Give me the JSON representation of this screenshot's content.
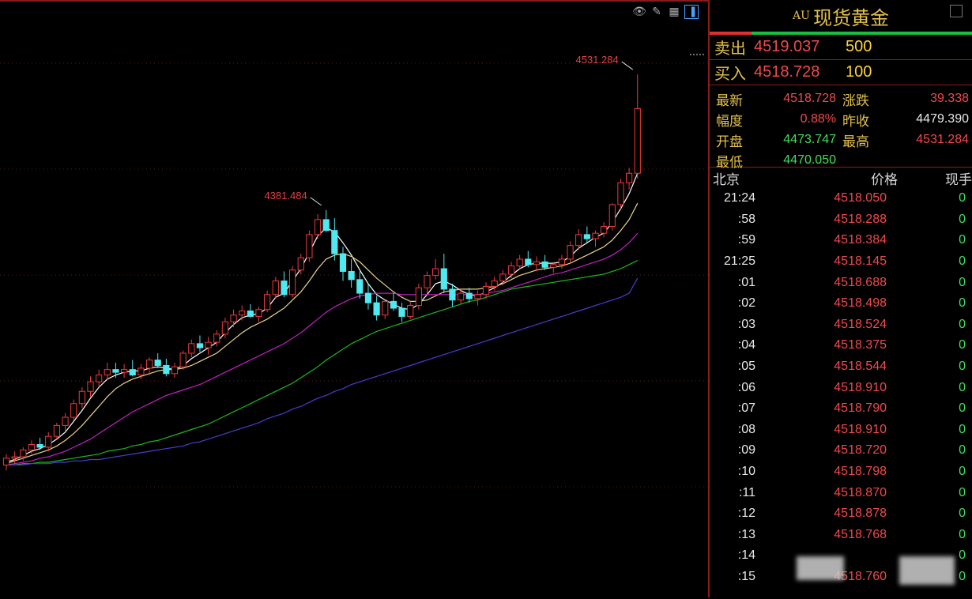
{
  "toolbar": {
    "icons": [
      "eye-icon",
      "pen-icon",
      "grid-icon",
      "panel-icon"
    ]
  },
  "chart_annotations": {
    "high_label": "4531.284",
    "peak_label": "4381.484"
  },
  "chart_data": {
    "type": "candlestick",
    "ylim": [
      4380,
      4540
    ],
    "candles": [
      [
        4388.0,
        4392.0,
        4386.0,
        4390.5
      ],
      [
        4390.5,
        4393.0,
        4388.5,
        4391.0
      ],
      [
        4391.0,
        4394.5,
        4389.5,
        4393.5
      ],
      [
        4393.5,
        4397.0,
        4392.0,
        4395.5
      ],
      [
        4395.5,
        4398.0,
        4393.5,
        4394.5
      ],
      [
        4394.5,
        4400.0,
        4393.0,
        4398.5
      ],
      [
        4398.5,
        4403.5,
        4397.5,
        4402.5
      ],
      [
        4402.5,
        4407.0,
        4400.5,
        4405.5
      ],
      [
        4405.5,
        4412.0,
        4404.5,
        4410.5
      ],
      [
        4410.5,
        4416.5,
        4409.0,
        4415.0
      ],
      [
        4415.0,
        4420.5,
        4413.0,
        4418.5
      ],
      [
        4418.5,
        4423.0,
        4416.5,
        4421.0
      ],
      [
        4421.0,
        4425.5,
        4419.0,
        4423.0
      ],
      [
        4423.0,
        4425.5,
        4420.0,
        4422.0
      ],
      [
        4422.0,
        4425.0,
        4420.0,
        4423.0
      ],
      [
        4423.0,
        4426.5,
        4420.5,
        4421.0
      ],
      [
        4421.0,
        4425.0,
        4419.5,
        4423.5
      ],
      [
        4423.5,
        4427.5,
        4421.0,
        4426.5
      ],
      [
        4426.5,
        4429.0,
        4423.5,
        4424.5
      ],
      [
        4424.5,
        4427.0,
        4420.5,
        4421.5
      ],
      [
        4421.5,
        4425.5,
        4420.0,
        4424.0
      ],
      [
        4424.0,
        4430.0,
        4423.0,
        4429.0
      ],
      [
        4429.0,
        4434.0,
        4427.5,
        4432.5
      ],
      [
        4432.5,
        4435.5,
        4429.5,
        4431.0
      ],
      [
        4431.0,
        4435.0,
        4428.5,
        4433.0
      ],
      [
        4433.0,
        4437.5,
        4431.5,
        4436.0
      ],
      [
        4436.0,
        4442.0,
        4434.5,
        4440.5
      ],
      [
        4440.5,
        4445.0,
        4438.5,
        4443.0
      ],
      [
        4443.0,
        4446.5,
        4441.0,
        4444.5
      ],
      [
        4444.5,
        4447.0,
        4442.0,
        4442.5
      ],
      [
        4442.5,
        4446.0,
        4440.5,
        4445.0
      ],
      [
        4445.0,
        4452.0,
        4444.0,
        4450.5
      ],
      [
        4450.5,
        4457.0,
        4449.0,
        4455.5
      ],
      [
        4455.5,
        4459.0,
        4449.5,
        4450.5
      ],
      [
        4450.5,
        4461.0,
        4449.5,
        4459.5
      ],
      [
        4459.5,
        4465.5,
        4458.0,
        4464.0
      ],
      [
        4464.0,
        4474.0,
        4462.5,
        4472.5
      ],
      [
        4472.5,
        4480.0,
        4471.0,
        4478.0
      ],
      [
        4478.0,
        4481.484,
        4473.5,
        4474.0
      ],
      [
        4474.0,
        4478.5,
        4463.0,
        4465.5
      ],
      [
        4465.5,
        4468.0,
        4455.5,
        4459.0
      ],
      [
        4459.0,
        4463.5,
        4453.0,
        4456.0
      ],
      [
        4456.0,
        4459.0,
        4449.0,
        4451.0
      ],
      [
        4451.0,
        4454.5,
        4445.0,
        4447.5
      ],
      [
        4447.5,
        4450.0,
        4441.0,
        4443.0
      ],
      [
        4443.0,
        4449.0,
        4441.5,
        4448.0
      ],
      [
        4448.0,
        4451.0,
        4444.5,
        4445.5
      ],
      [
        4445.5,
        4447.5,
        4440.5,
        4442.5
      ],
      [
        4442.5,
        4448.0,
        4441.5,
        4446.5
      ],
      [
        4446.5,
        4454.5,
        4445.0,
        4453.0
      ],
      [
        4453.0,
        4459.0,
        4451.0,
        4457.5
      ],
      [
        4457.5,
        4463.5,
        4456.0,
        4460.0
      ],
      [
        4460.0,
        4465.5,
        4451.0,
        4452.5
      ],
      [
        4452.5,
        4454.5,
        4446.0,
        4448.5
      ],
      [
        4448.5,
        4452.5,
        4447.0,
        4451.0
      ],
      [
        4451.0,
        4453.0,
        4447.5,
        4449.0
      ],
      [
        4449.0,
        4452.0,
        4446.5,
        4450.5
      ],
      [
        4450.5,
        4455.0,
        4449.0,
        4453.5
      ],
      [
        4453.5,
        4457.0,
        4452.0,
        4455.5
      ],
      [
        4455.5,
        4459.5,
        4454.0,
        4458.0
      ],
      [
        4458.0,
        4462.5,
        4456.5,
        4461.0
      ],
      [
        4461.0,
        4465.0,
        4459.5,
        4463.5
      ],
      [
        4463.5,
        4466.5,
        4460.5,
        4461.5
      ],
      [
        4461.5,
        4464.5,
        4459.0,
        4462.5
      ],
      [
        4462.5,
        4465.0,
        4459.5,
        4460.5
      ],
      [
        4460.5,
        4462.5,
        4458.5,
        4461.5
      ],
      [
        4461.5,
        4465.0,
        4460.0,
        4463.5
      ],
      [
        4463.5,
        4470.0,
        4462.0,
        4468.5
      ],
      [
        4468.5,
        4474.5,
        4467.0,
        4472.5
      ],
      [
        4472.5,
        4475.5,
        4469.5,
        4471.0
      ],
      [
        4471.0,
        4474.0,
        4468.0,
        4473.0
      ],
      [
        4473.0,
        4477.0,
        4471.5,
        4475.5
      ],
      [
        4475.5,
        4484.0,
        4474.0,
        4483.5
      ],
      [
        4483.5,
        4493.0,
        4482.0,
        4491.5
      ],
      [
        4491.5,
        4497.0,
        4489.0,
        4495.0
      ],
      [
        4495.0,
        4531.284,
        4493.0,
        4518.728
      ]
    ],
    "series": [
      {
        "color": "#ffffff",
        "values": [
          4389.0,
          4390.0,
          4391.5,
          4393.0,
          4394.0,
          4395.5,
          4397.5,
          4400.0,
          4404.0,
          4408.0,
          4412.5,
          4416.5,
          4419.5,
          4421.0,
          4422.0,
          4422.5,
          4422.5,
          4423.5,
          4424.0,
          4423.5,
          4423.0,
          4424.5,
          4427.0,
          4429.0,
          4431.0,
          4433.0,
          4436.5,
          4439.5,
          4442.0,
          4443.0,
          4443.5,
          4445.5,
          4449.5,
          4451.0,
          4455.5,
          4460.0,
          4466.0,
          4472.0,
          4475.0,
          4473.5,
          4469.5,
          4465.0,
          4459.5,
          4454.5,
          4450.5,
          4448.5,
          4447.0,
          4445.5,
          4445.0,
          4447.0,
          4450.5,
          4454.5,
          4455.5,
          4454.0,
          4452.0,
          4450.5,
          4450.0,
          4451.5,
          4453.0,
          4455.0,
          4457.5,
          4460.0,
          4461.5,
          4462.0,
          4462.0,
          4462.0,
          4462.5,
          4464.5,
          4467.5,
          4469.5,
          4471.5,
          4473.0,
          4477.0,
          4482.0,
          4487.5,
          4495.0
        ]
      },
      {
        "color": "#e8d58a",
        "values": [
          4388.5,
          4389.5,
          4390.5,
          4391.5,
          4392.5,
          4393.5,
          4395.0,
          4397.0,
          4399.5,
          4402.5,
          4406.0,
          4409.5,
          4413.0,
          4416.0,
          4418.0,
          4419.5,
          4420.5,
          4421.5,
          4422.5,
          4423.0,
          4423.0,
          4423.5,
          4424.5,
          4426.0,
          4427.5,
          4429.0,
          4431.5,
          4434.0,
          4436.5,
          4438.5,
          4440.0,
          4441.5,
          4443.5,
          4445.5,
          4448.5,
          4451.5,
          4455.5,
          4460.0,
          4463.5,
          4465.0,
          4465.5,
          4464.5,
          4462.5,
          4459.5,
          4456.5,
          4454.0,
          4451.5,
          4449.5,
          4448.0,
          4448.0,
          4448.5,
          4450.0,
          4451.5,
          4452.0,
          4452.5,
          4452.5,
          4452.5,
          4453.0,
          4453.5,
          4454.5,
          4456.0,
          4457.5,
          4458.5,
          4459.5,
          4460.0,
          4460.5,
          4461.0,
          4462.0,
          4463.5,
          4465.0,
          4466.5,
          4468.0,
          4470.5,
          4474.0,
          4478.0,
          4484.0
        ]
      },
      {
        "color": "#c41fc4",
        "values": [
          4388.0,
          4388.5,
          4389.0,
          4389.5,
          4390.5,
          4391.0,
          4392.0,
          4393.0,
          4394.5,
          4396.0,
          4397.5,
          4399.5,
          4401.5,
          4403.5,
          4405.5,
          4407.5,
          4409.0,
          4410.5,
          4412.0,
          4413.5,
          4414.5,
          4415.5,
          4416.5,
          4417.5,
          4419.0,
          4420.5,
          4422.0,
          4423.5,
          4425.0,
          4426.5,
          4428.0,
          4429.5,
          4431.0,
          4432.5,
          4434.5,
          4436.5,
          4439.0,
          4441.5,
          4444.0,
          4446.0,
          4447.5,
          4449.0,
          4450.0,
          4450.5,
          4451.0,
          4451.0,
          4451.0,
          4450.5,
          4450.5,
          4450.5,
          4450.5,
          4450.5,
          4450.5,
          4450.5,
          4450.5,
          4450.5,
          4450.5,
          4451.0,
          4451.5,
          4452.0,
          4453.0,
          4454.0,
          4455.0,
          4456.0,
          4457.0,
          4458.0,
          4458.5,
          4459.5,
          4460.5,
          4461.5,
          4462.5,
          4463.5,
          4465.0,
          4467.0,
          4469.5,
          4473.0
        ]
      },
      {
        "color": "#1db81d",
        "values": [
          4388.0,
          4388.0,
          4388.5,
          4388.5,
          4389.0,
          4389.0,
          4389.5,
          4390.0,
          4390.5,
          4391.0,
          4391.5,
          4392.0,
          4393.0,
          4393.5,
          4394.0,
          4395.0,
          4395.5,
          4396.5,
          4397.0,
          4398.0,
          4399.0,
          4400.0,
          4401.0,
          4402.0,
          4403.0,
          4404.5,
          4406.0,
          4407.5,
          4409.0,
          4410.5,
          4412.0,
          4413.5,
          4415.0,
          4416.5,
          4418.0,
          4420.0,
          4422.0,
          4424.0,
          4426.5,
          4428.5,
          4430.5,
          4432.5,
          4434.0,
          4435.5,
          4437.0,
          4438.0,
          4439.0,
          4440.0,
          4441.0,
          4442.0,
          4443.0,
          4444.0,
          4445.0,
          4446.0,
          4447.0,
          4448.0,
          4448.5,
          4449.5,
          4450.5,
          4451.5,
          4452.5,
          4453.0,
          4453.5,
          4454.0,
          4454.5,
          4455.0,
          4455.5,
          4456.0,
          4456.5,
          4457.0,
          4457.5,
          4458.0,
          4459.0,
          4460.0,
          4461.5,
          4463.0
        ]
      },
      {
        "color": "#4a3ccf",
        "values": [
          4388.0,
          4388.0,
          4388.0,
          4388.5,
          4388.5,
          4388.5,
          4389.0,
          4389.0,
          4389.5,
          4389.5,
          4390.0,
          4390.0,
          4390.5,
          4391.0,
          4391.5,
          4392.0,
          4392.5,
          4393.0,
          4393.5,
          4394.0,
          4394.5,
          4395.0,
          4396.0,
          4396.5,
          4397.5,
          4398.5,
          4399.5,
          4400.5,
          4401.5,
          4402.5,
          4403.5,
          4405.0,
          4406.0,
          4407.0,
          4408.5,
          4409.5,
          4411.0,
          4412.5,
          4413.5,
          4415.0,
          4416.0,
          4417.5,
          4418.5,
          4419.5,
          4420.5,
          4421.5,
          4422.5,
          4423.5,
          4424.5,
          4425.5,
          4426.5,
          4427.5,
          4428.5,
          4429.5,
          4430.5,
          4431.5,
          4432.5,
          4433.5,
          4434.5,
          4435.5,
          4436.5,
          4437.5,
          4438.5,
          4439.5,
          4440.5,
          4441.5,
          4442.5,
          4443.5,
          4444.5,
          4445.5,
          4446.5,
          4447.5,
          4448.5,
          4449.5,
          4451.0,
          4456.5
        ]
      }
    ],
    "annotations": [
      {
        "label": "4531.284",
        "index": 75,
        "value": 4531.284
      },
      {
        "label": "4381.484",
        "index": 38,
        "value": 4481.484
      }
    ]
  },
  "panel": {
    "code": "AU",
    "name": "现货黄金",
    "sell": {
      "label": "卖出",
      "price": "4519.037",
      "volume": "500"
    },
    "buy": {
      "label": "买入",
      "price": "4518.728",
      "volume": "100"
    },
    "stats": {
      "latest_label": "最新",
      "latest": "4518.728",
      "change_label": "涨跌",
      "change": "39.338",
      "pct_label": "幅度",
      "pct": "0.88%",
      "prev_label": "昨收",
      "prev": "4479.390",
      "open_label": "开盘",
      "open": "4473.747",
      "high_label": "最高",
      "high": "4531.284",
      "low_label": "最低",
      "low": "4470.050"
    },
    "ticks_header": {
      "time": "北京",
      "price": "价格",
      "volume": "现手"
    },
    "ticks": [
      {
        "time": "21:24",
        "price": "4518.050",
        "volume": "0"
      },
      {
        "time": ":58",
        "price": "4518.288",
        "volume": "0"
      },
      {
        "time": ":59",
        "price": "4518.384",
        "volume": "0"
      },
      {
        "time": "21:25",
        "price": "4518.145",
        "volume": "0"
      },
      {
        "time": ":01",
        "price": "4518.688",
        "volume": "0"
      },
      {
        "time": ":02",
        "price": "4518.498",
        "volume": "0"
      },
      {
        "time": ":03",
        "price": "4518.524",
        "volume": "0"
      },
      {
        "time": ":04",
        "price": "4518.375",
        "volume": "0"
      },
      {
        "time": ":05",
        "price": "4518.544",
        "volume": "0"
      },
      {
        "time": ":06",
        "price": "4518.910",
        "volume": "0"
      },
      {
        "time": ":07",
        "price": "4518.790",
        "volume": "0"
      },
      {
        "time": ":08",
        "price": "4518.910",
        "volume": "0"
      },
      {
        "time": ":09",
        "price": "4518.720",
        "volume": "0"
      },
      {
        "time": ":10",
        "price": "4518.798",
        "volume": "0"
      },
      {
        "time": ":11",
        "price": "4518.870",
        "volume": "0"
      },
      {
        "time": ":12",
        "price": "4518.878",
        "volume": "0"
      },
      {
        "time": ":13",
        "price": "4518.768",
        "volume": "0"
      },
      {
        "time": ":14",
        "price": "",
        "volume": "0"
      },
      {
        "time": ":15",
        "price": "4518.760",
        "volume": "0"
      }
    ]
  }
}
